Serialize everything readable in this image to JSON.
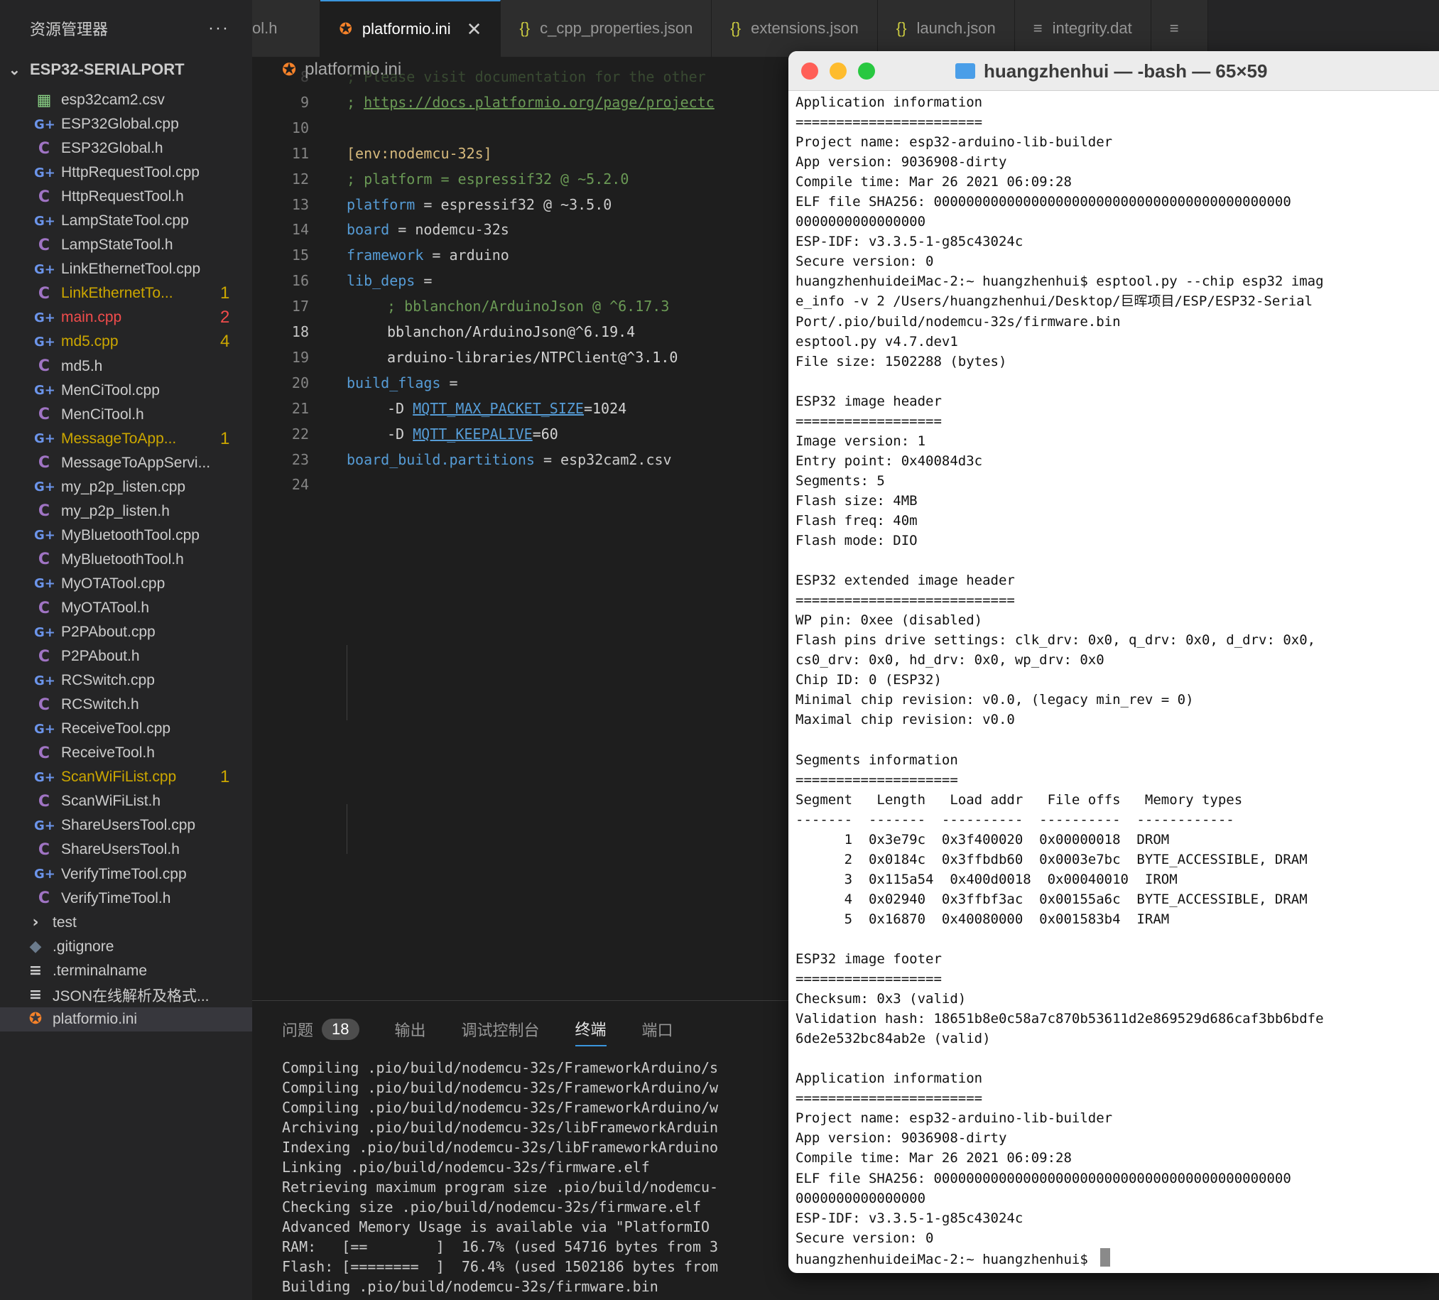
{
  "sidebar": {
    "title": "资源管理器",
    "more": "···",
    "project": "ESP32-SERIALPORT",
    "files": [
      {
        "name": "esp32cam2.csv",
        "type": "csv",
        "badge": "",
        "status": "normal"
      },
      {
        "name": "ESP32Global.cpp",
        "type": "cpp",
        "badge": "",
        "status": "normal"
      },
      {
        "name": "ESP32Global.h",
        "type": "h",
        "badge": "",
        "status": "normal"
      },
      {
        "name": "HttpRequestTool.cpp",
        "type": "cpp",
        "badge": "",
        "status": "normal"
      },
      {
        "name": "HttpRequestTool.h",
        "type": "h",
        "badge": "",
        "status": "normal"
      },
      {
        "name": "LampStateTool.cpp",
        "type": "cpp",
        "badge": "",
        "status": "normal"
      },
      {
        "name": "LampStateTool.h",
        "type": "h",
        "badge": "",
        "status": "normal"
      },
      {
        "name": "LinkEthernetTool.cpp",
        "type": "cpp",
        "badge": "",
        "status": "normal"
      },
      {
        "name": "LinkEthernetTo...",
        "type": "h",
        "badge": "1",
        "status": "warn"
      },
      {
        "name": "main.cpp",
        "type": "cpp",
        "badge": "2",
        "status": "err"
      },
      {
        "name": "md5.cpp",
        "type": "cpp",
        "badge": "4",
        "status": "warn"
      },
      {
        "name": "md5.h",
        "type": "h",
        "badge": "",
        "status": "normal"
      },
      {
        "name": "MenCiTool.cpp",
        "type": "cpp",
        "badge": "",
        "status": "normal"
      },
      {
        "name": "MenCiTool.h",
        "type": "h",
        "badge": "",
        "status": "normal"
      },
      {
        "name": "MessageToApp...",
        "type": "cpp",
        "badge": "1",
        "status": "warn"
      },
      {
        "name": "MessageToAppServi...",
        "type": "h",
        "badge": "",
        "status": "normal"
      },
      {
        "name": "my_p2p_listen.cpp",
        "type": "cpp",
        "badge": "",
        "status": "normal"
      },
      {
        "name": "my_p2p_listen.h",
        "type": "h",
        "badge": "",
        "status": "normal"
      },
      {
        "name": "MyBluetoothTool.cpp",
        "type": "cpp",
        "badge": "",
        "status": "normal"
      },
      {
        "name": "MyBluetoothTool.h",
        "type": "h",
        "badge": "",
        "status": "normal"
      },
      {
        "name": "MyOTATool.cpp",
        "type": "cpp",
        "badge": "",
        "status": "normal"
      },
      {
        "name": "MyOTATool.h",
        "type": "h",
        "badge": "",
        "status": "normal"
      },
      {
        "name": "P2PAbout.cpp",
        "type": "cpp",
        "badge": "",
        "status": "normal"
      },
      {
        "name": "P2PAbout.h",
        "type": "h",
        "badge": "",
        "status": "normal"
      },
      {
        "name": "RCSwitch.cpp",
        "type": "cpp",
        "badge": "",
        "status": "normal"
      },
      {
        "name": "RCSwitch.h",
        "type": "h",
        "badge": "",
        "status": "normal"
      },
      {
        "name": "ReceiveTool.cpp",
        "type": "cpp",
        "badge": "",
        "status": "normal"
      },
      {
        "name": "ReceiveTool.h",
        "type": "h",
        "badge": "",
        "status": "normal"
      },
      {
        "name": "ScanWiFiList.cpp",
        "type": "cpp",
        "badge": "1",
        "status": "warn"
      },
      {
        "name": "ScanWiFiList.h",
        "type": "h",
        "badge": "",
        "status": "normal"
      },
      {
        "name": "ShareUsersTool.cpp",
        "type": "cpp",
        "badge": "",
        "status": "normal"
      },
      {
        "name": "ShareUsersTool.h",
        "type": "h",
        "badge": "",
        "status": "normal"
      },
      {
        "name": "VerifyTimeTool.cpp",
        "type": "cpp",
        "badge": "",
        "status": "normal"
      },
      {
        "name": "VerifyTimeTool.h",
        "type": "h",
        "badge": "",
        "status": "normal"
      },
      {
        "name": "test",
        "type": "folder",
        "badge": "",
        "status": "normal"
      },
      {
        "name": ".gitignore",
        "type": "git",
        "badge": "",
        "status": "normal"
      },
      {
        "name": ".terminalname",
        "type": "lines",
        "badge": "",
        "status": "normal"
      },
      {
        "name": "JSON在线解析及格式...",
        "type": "lines",
        "badge": "",
        "status": "normal"
      },
      {
        "name": "platformio.ini",
        "type": "pio",
        "badge": "",
        "status": "selected"
      }
    ]
  },
  "tabs": [
    {
      "label": "ol.h",
      "icon": "",
      "kind": "plain",
      "active": false
    },
    {
      "label": "platformio.ini",
      "icon": "pio",
      "kind": "pio",
      "active": true,
      "close": "✕"
    },
    {
      "label": "c_cpp_properties.json",
      "icon": "{}",
      "kind": "json",
      "active": false
    },
    {
      "label": "extensions.json",
      "icon": "{}",
      "kind": "json",
      "active": false
    },
    {
      "label": "launch.json",
      "icon": "{}",
      "kind": "json",
      "active": false
    },
    {
      "label": "integrity.dat",
      "icon": "≡",
      "kind": "plain",
      "active": false
    },
    {
      "label": "",
      "icon": "≡",
      "kind": "plain",
      "active": false
    }
  ],
  "breadcrumb": "platformio.ini",
  "editor": {
    "current_line": "18",
    "lines": [
      {
        "n": "8",
        "segs": [
          {
            "t": "; Please visit documentation for the other",
            "c": "comment"
          }
        ]
      },
      {
        "n": "9",
        "segs": [
          {
            "t": "; ",
            "c": "comment"
          },
          {
            "t": "https://docs.platformio.org/page/projectc",
            "c": "link"
          }
        ]
      },
      {
        "n": "10",
        "segs": []
      },
      {
        "n": "11",
        "segs": [
          {
            "t": "[env:nodemcu-32s]",
            "c": "section"
          }
        ]
      },
      {
        "n": "12",
        "segs": [
          {
            "t": "; platform = espressif32 @ ~5.2.0",
            "c": "comment"
          }
        ]
      },
      {
        "n": "13",
        "segs": [
          {
            "t": "platform",
            "c": "key"
          },
          {
            "t": " = espressif32 @ ~3.5.0",
            "c": "val"
          }
        ]
      },
      {
        "n": "14",
        "segs": [
          {
            "t": "board",
            "c": "key"
          },
          {
            "t": " = nodemcu-32s",
            "c": "val"
          }
        ]
      },
      {
        "n": "15",
        "segs": [
          {
            "t": "framework",
            "c": "key"
          },
          {
            "t": " = arduino",
            "c": "val"
          }
        ]
      },
      {
        "n": "16",
        "segs": [
          {
            "t": "lib_deps",
            "c": "key"
          },
          {
            "t": " =",
            "c": "val"
          }
        ]
      },
      {
        "n": "17",
        "indent": true,
        "segs": [
          {
            "t": "; bblanchon/ArduinoJson @ ^6.17.3",
            "c": "comment"
          }
        ]
      },
      {
        "n": "18",
        "indent": true,
        "segs": [
          {
            "t": "bblanchon/ArduinoJson@^6.19.4",
            "c": "str"
          }
        ]
      },
      {
        "n": "19",
        "indent": true,
        "segs": [
          {
            "t": "arduino-libraries/NTPClient@^3.1.0",
            "c": "str"
          }
        ]
      },
      {
        "n": "20",
        "segs": [
          {
            "t": "build_flags",
            "c": "key"
          },
          {
            "t": " =",
            "c": "val"
          }
        ]
      },
      {
        "n": "21",
        "indent": true,
        "segs": [
          {
            "t": "-D ",
            "c": "str"
          },
          {
            "t": "MQTT_MAX_PACKET_SIZE",
            "c": "macro"
          },
          {
            "t": "=1024",
            "c": "str"
          }
        ]
      },
      {
        "n": "22",
        "indent": true,
        "segs": [
          {
            "t": "-D ",
            "c": "str"
          },
          {
            "t": "MQTT_KEEPALIVE",
            "c": "macro"
          },
          {
            "t": "=60",
            "c": "str"
          }
        ]
      },
      {
        "n": "23",
        "segs": [
          {
            "t": "board_build.partitions",
            "c": "key"
          },
          {
            "t": " = esp32cam2.csv",
            "c": "val"
          }
        ]
      },
      {
        "n": "24",
        "segs": []
      }
    ]
  },
  "panel": {
    "tabs": [
      {
        "label": "问题",
        "badge": "18",
        "active": false
      },
      {
        "label": "输出",
        "badge": "",
        "active": false
      },
      {
        "label": "调试控制台",
        "badge": "",
        "active": false
      },
      {
        "label": "终端",
        "badge": "",
        "active": true
      },
      {
        "label": "端口",
        "badge": "",
        "active": false
      }
    ],
    "output": [
      "Compiling .pio/build/nodemcu-32s/FrameworkArduino/s",
      "Compiling .pio/build/nodemcu-32s/FrameworkArduino/w",
      "Compiling .pio/build/nodemcu-32s/FrameworkArduino/w",
      "Archiving .pio/build/nodemcu-32s/libFrameworkArduin",
      "Indexing .pio/build/nodemcu-32s/libFrameworkArduino",
      "Linking .pio/build/nodemcu-32s/firmware.elf",
      "Retrieving maximum program size .pio/build/nodemcu-",
      "Checking size .pio/build/nodemcu-32s/firmware.elf",
      "Advanced Memory Usage is available via \"PlatformIO",
      "RAM:   [==        ]  16.7% (used 54716 bytes from 3",
      "Flash: [========  ]  76.4% (used 1502186 bytes from",
      "Building .pio/build/nodemcu-32s/firmware.bin"
    ]
  },
  "terminal": {
    "title": "huangzhenhui — -bash — 65×59",
    "lines": [
      "Application information",
      "=======================",
      "Project name: esp32-arduino-lib-builder",
      "App version: 9036908-dirty",
      "Compile time: Mar 26 2021 06:09:28",
      "ELF file SHA256: 00000000000000000000000000000000000000000000",
      "0000000000000000",
      "ESP-IDF: v3.3.5-1-g85c43024c",
      "Secure version: 0",
      "huangzhenhuideiMac-2:~ huangzhenhui$ esptool.py --chip esp32 imag",
      "e_info -v 2 /Users/huangzhenhui/Desktop/巨晖项目/ESP/ESP32-Serial",
      "Port/.pio/build/nodemcu-32s/firmware.bin",
      "esptool.py v4.7.dev1",
      "File size: 1502288 (bytes)",
      "",
      "ESP32 image header",
      "==================",
      "Image version: 1",
      "Entry point: 0x40084d3c",
      "Segments: 5",
      "Flash size: 4MB",
      "Flash freq: 40m",
      "Flash mode: DIO",
      "",
      "ESP32 extended image header",
      "===========================",
      "WP pin: 0xee (disabled)",
      "Flash pins drive settings: clk_drv: 0x0, q_drv: 0x0, d_drv: 0x0,",
      "cs0_drv: 0x0, hd_drv: 0x0, wp_drv: 0x0",
      "Chip ID: 0 (ESP32)",
      "Minimal chip revision: v0.0, (legacy min_rev = 0)",
      "Maximal chip revision: v0.0",
      "",
      "Segments information",
      "====================",
      "Segment   Length   Load addr   File offs   Memory types",
      "-------  -------  ----------  ----------  ------------",
      "      1  0x3e79c  0x3f400020  0x00000018  DROM",
      "      2  0x0184c  0x3ffbdb60  0x0003e7bc  BYTE_ACCESSIBLE, DRAM",
      "      3  0x115a54  0x400d0018  0x00040010  IROM",
      "      4  0x02940  0x3ffbf3ac  0x00155a6c  BYTE_ACCESSIBLE, DRAM",
      "      5  0x16870  0x40080000  0x001583b4  IRAM",
      "",
      "ESP32 image footer",
      "==================",
      "Checksum: 0x3 (valid)",
      "Validation hash: 18651b8e0c58a7c870b53611d2e869529d686caf3bb6bdfe",
      "6de2e532bc84ab2e (valid)",
      "",
      "Application information",
      "=======================",
      "Project name: esp32-arduino-lib-builder",
      "App version: 9036908-dirty",
      "Compile time: Mar 26 2021 06:09:28",
      "ELF file SHA256: 00000000000000000000000000000000000000000000",
      "0000000000000000",
      "ESP-IDF: v3.3.5-1-g85c43024c",
      "Secure version: 0"
    ],
    "prompt": "huangzhenhuideiMac-2:~ huangzhenhui$ "
  }
}
